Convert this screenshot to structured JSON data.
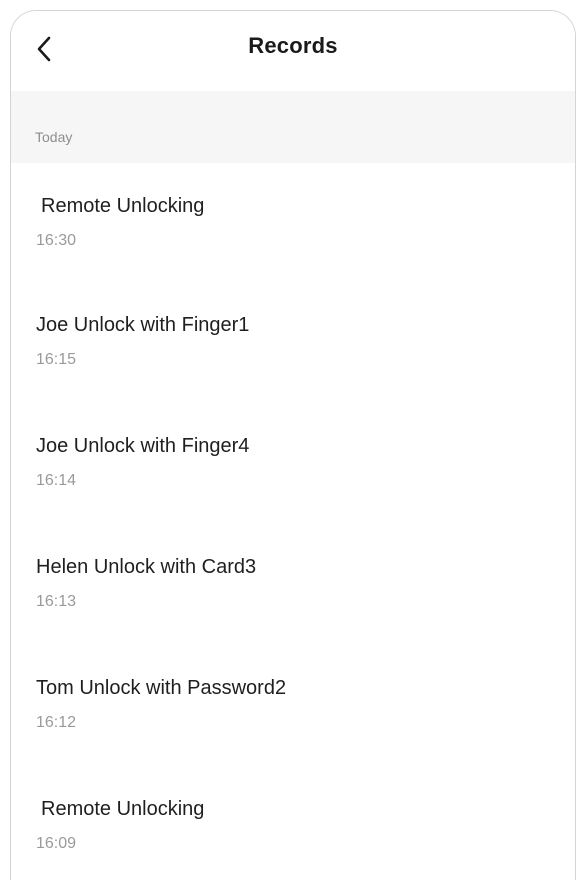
{
  "header": {
    "title": "Records",
    "back_icon": "chevron-left-icon"
  },
  "section": {
    "label": "Today"
  },
  "records": [
    {
      "title": "Remote Unlocking",
      "time": "16:30"
    },
    {
      "title": "Joe Unlock with Finger1",
      "time": "16:15"
    },
    {
      "title": "Joe Unlock with Finger4",
      "time": "16:14"
    },
    {
      "title": "Helen Unlock with Card3",
      "time": "16:13"
    },
    {
      "title": "Tom Unlock with Password2",
      "time": "16:12"
    },
    {
      "title": "Remote Unlocking",
      "time": "16:09"
    }
  ],
  "colors": {
    "section_background": "#f6f6f6",
    "title_text": "#1a1a1a",
    "secondary_text": "#9a9a9a"
  }
}
